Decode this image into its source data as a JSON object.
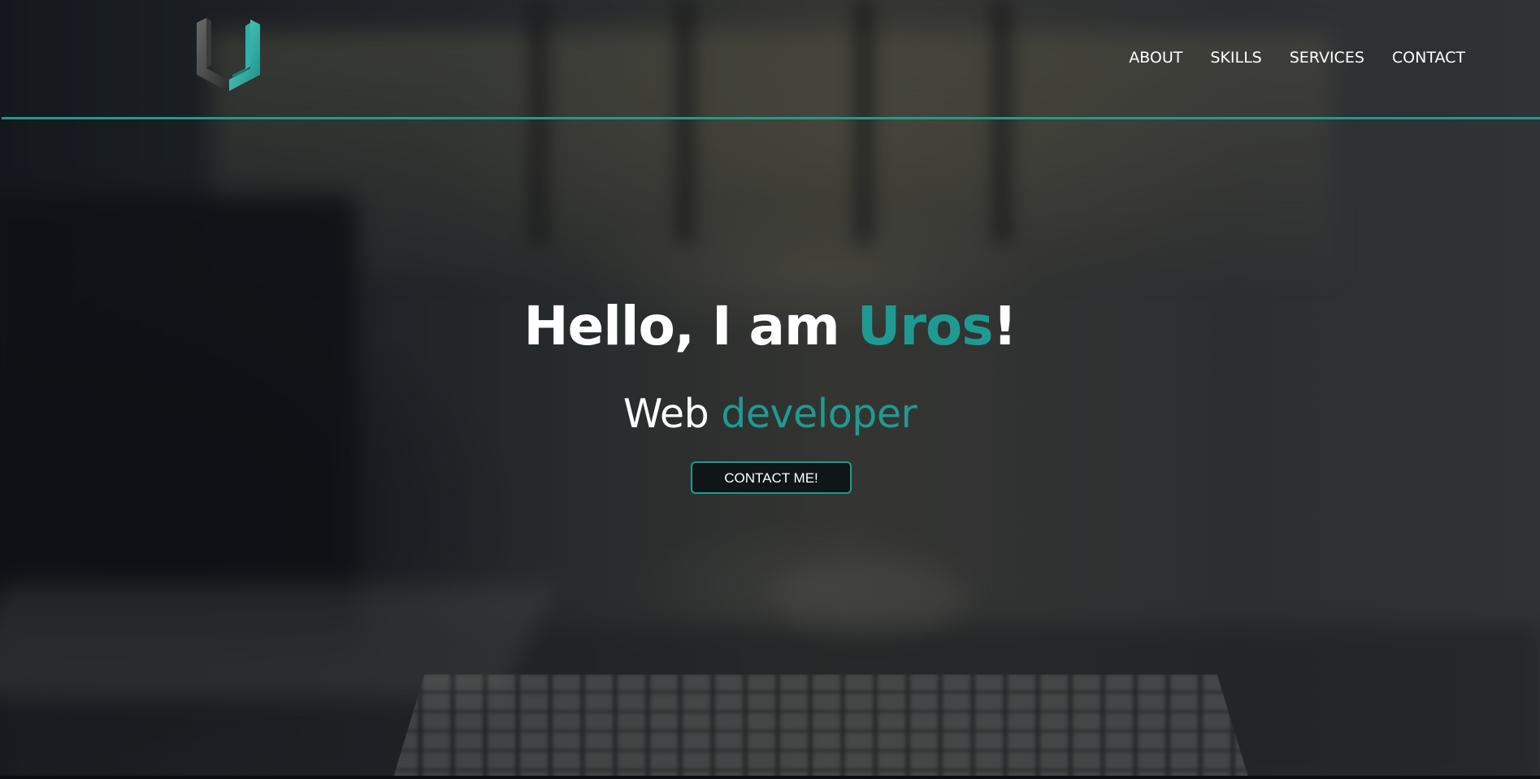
{
  "header": {
    "logo_icon": "u-letter-logo-icon",
    "nav": [
      {
        "label": "ABOUT"
      },
      {
        "label": "SKILLS"
      },
      {
        "label": "SERVICES"
      },
      {
        "label": "CONTACT"
      }
    ]
  },
  "hero": {
    "title_prefix": "Hello, I am ",
    "title_name": "Uros",
    "title_suffix": "!",
    "subtitle_prefix": "Web ",
    "subtitle_accent": "developer",
    "cta_label": "CONTACT ME!"
  },
  "colors": {
    "accent": "#1f9a92",
    "text": "#ffffff",
    "button_bg": "#101518"
  }
}
